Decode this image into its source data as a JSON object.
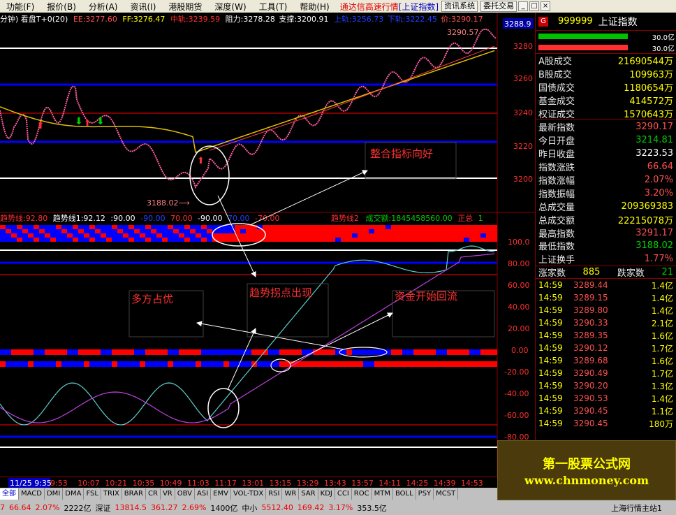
{
  "menu": {
    "items": [
      "功能(F)",
      "报价(B)",
      "分析(A)",
      "资讯(I)",
      "港股期货",
      "深度(W)",
      "工具(T)",
      "帮助(H)"
    ],
    "title_red": "通达信高速行情",
    "title_blue": "[上证指数]",
    "btn_sys": "资讯系统",
    "btn_trade": "委托交易",
    "win_min": "_",
    "win_max": "□",
    "win_close": "×"
  },
  "main_chart": {
    "info": {
      "period": "分钟) 看盘T+0(20)",
      "ee": "EE:3277.60",
      "ff": "FF:3276.47",
      "zg": "中轨:3239.59",
      "zl": "阻力:3278.28",
      "zc": "支撑:3200.91",
      "sg": "上轨:3256.73",
      "xg": "下轨:3222.45",
      "jia": "价:3290.17"
    },
    "high_label": "3290.57",
    "low_label": "3188.02",
    "cur_price_box": "3288.9",
    "y_ticks": [
      "3280",
      "3260",
      "3240",
      "3220",
      "3200"
    ],
    "annotations": {
      "zhenghe": "整合指标向好",
      "duofang": "多方占优",
      "qushi": "趋势拐点出现",
      "zijin": "资金开始回流"
    }
  },
  "trend_bar": {
    "info_left": "趋势线:92.80",
    "info_line1": "趋势线1:92.12",
    "info_v1": ":90.00",
    "info_v2": "-90.00",
    "info_v3": "70.00",
    "info_v4": "-90.00",
    "info_v5": "70.00",
    "info_v6": "-70.00",
    "info_line2": "趋势线2",
    "info_amount": "成交额:1845458560.00",
    "info_zz": "正总",
    "info_one": "1"
  },
  "osc_chart": {
    "y_ticks": [
      "100.0",
      "80.00",
      "60.00",
      "40.00",
      "20.00",
      "0.00",
      "-20.00",
      "-40.00",
      "-60.00",
      "-80.00"
    ]
  },
  "time_axis": {
    "selected": "11/25 9:35",
    "ticks": [
      "9:53",
      "10:07",
      "10:21",
      "10:35",
      "10:49",
      "11:03",
      "11:17",
      "13:01",
      "13:15",
      "13:29",
      "13:43",
      "13:57",
      "14:11",
      "14:25",
      "14:39",
      "14:53"
    ]
  },
  "tabs": [
    "全部",
    "MACD",
    "DMI",
    "DMA",
    "FSL",
    "TRIX",
    "BRAR",
    "CR",
    "VR",
    "OBV",
    "ASI",
    "EMV",
    "VOL-TDX",
    "RSI",
    "WR",
    "SAR",
    "KDJ",
    "CCI",
    "ROC",
    "MTM",
    "BOLL",
    "PSY",
    "MCST"
  ],
  "status": {
    "s1": "7",
    "s2": "66.64",
    "s3": "2.07%",
    "s4": "2222亿",
    "s5": "深证",
    "s6": "13814.5",
    "s7": "361.27",
    "s8": "2.69%",
    "s9": "1400亿",
    "s10": "中小",
    "s11": "5512.40",
    "s12": "169.42",
    "s13": "3.17%",
    "s14": "353.5亿",
    "s15": "上海行情主站1"
  },
  "panel": {
    "badge": "G",
    "code": "999999",
    "name": "上证指数",
    "vol1": "30.0亿",
    "vol2": "30.0亿",
    "rows1": [
      {
        "k": "A股成交",
        "v": "21690544万"
      },
      {
        "k": "B股成交",
        "v": "109963万"
      },
      {
        "k": "国债成交",
        "v": "1180654万"
      },
      {
        "k": "基金成交",
        "v": "414572万"
      },
      {
        "k": "权证成交",
        "v": "1570643万"
      }
    ],
    "rows2": [
      {
        "k": "最新指数",
        "v": "3290.17"
      },
      {
        "k": "今日开盘",
        "v": "3214.81"
      },
      {
        "k": "昨日收盘",
        "v": "3223.53"
      },
      {
        "k": "指数涨跌",
        "v": "66.64"
      },
      {
        "k": "指数涨幅",
        "v": "2.07%"
      },
      {
        "k": "指数振幅",
        "v": "3.20%"
      },
      {
        "k": "总成交量",
        "v": "209369383"
      },
      {
        "k": "总成交额",
        "v": "22215078万"
      },
      {
        "k": "最高指数",
        "v": "3291.17"
      },
      {
        "k": "最低指数",
        "v": "3188.02"
      },
      {
        "k": "上证换手",
        "v": "1.77%"
      }
    ],
    "up_label": "涨家数",
    "up_count": "885",
    "down_label": "跌家数",
    "down_count": "21",
    "ticks": [
      {
        "t": "14:59",
        "p": "3289.44",
        "v": "1.4亿"
      },
      {
        "t": "14:59",
        "p": "3289.15",
        "v": "1.4亿"
      },
      {
        "t": "14:59",
        "p": "3289.80",
        "v": "1.4亿"
      },
      {
        "t": "14:59",
        "p": "3290.33",
        "v": "2.1亿"
      },
      {
        "t": "14:59",
        "p": "3289.35",
        "v": "1.6亿"
      },
      {
        "t": "14:59",
        "p": "3290.12",
        "v": "1.7亿"
      },
      {
        "t": "14:59",
        "p": "3289.68",
        "v": "1.6亿"
      },
      {
        "t": "14:59",
        "p": "3290.49",
        "v": "1.7亿"
      },
      {
        "t": "14:59",
        "p": "3290.20",
        "v": "1.3亿"
      },
      {
        "t": "14:59",
        "p": "3290.53",
        "v": "1.4亿"
      },
      {
        "t": "14:59",
        "p": "3290.45",
        "v": "1.1亿"
      },
      {
        "t": "14:59",
        "p": "3290.45",
        "v": "180万"
      }
    ]
  },
  "banner": {
    "line1": "第一股票公式网",
    "line2": "www.chnmoney.com"
  },
  "colors": {
    "up": "#ff3030",
    "down": "#00d000",
    "band_blue": "#0000ff",
    "band_red": "#ff0000",
    "accent_yellow": "#ffff00"
  }
}
